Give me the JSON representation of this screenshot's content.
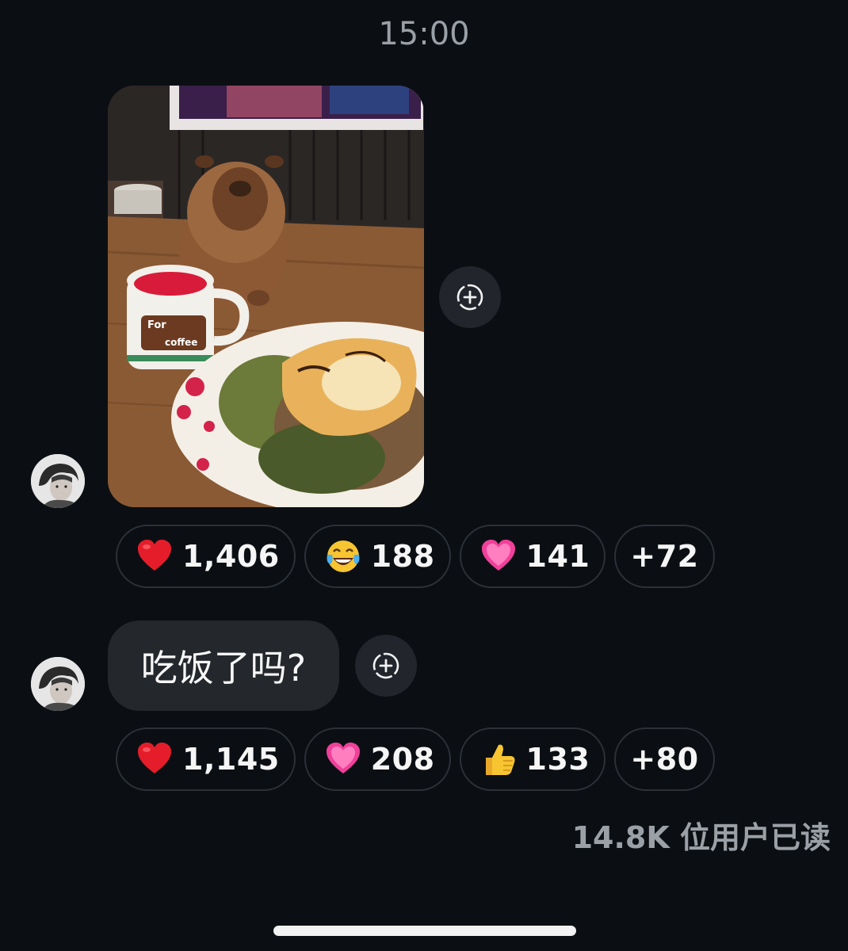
{
  "time": "15:00",
  "message_1": {
    "type": "image",
    "image_alt": "capybara plush with coffee mug and plate of food",
    "mug_text_1": "For",
    "mug_text_2": "coffee",
    "reactions": [
      {
        "emoji": "❤️",
        "icon": "red-heart-icon",
        "count": "1,406"
      },
      {
        "emoji": "😂",
        "icon": "tears-of-joy-icon",
        "count": "188"
      },
      {
        "emoji": "💗",
        "icon": "pink-heart-icon",
        "count": "141"
      }
    ],
    "more_reactions": "+72"
  },
  "message_2": {
    "type": "text",
    "text": "吃饭了吗?",
    "reactions": [
      {
        "emoji": "❤️",
        "icon": "red-heart-icon",
        "count": "1,145"
      },
      {
        "emoji": "💗",
        "icon": "pink-heart-icon",
        "count": "208"
      },
      {
        "emoji": "👍",
        "icon": "thumbs-up-icon",
        "count": "133"
      }
    ],
    "more_reactions": "+80"
  },
  "read_status": "14.8K 位用户已读",
  "colors": {
    "background": "#0b0f14",
    "bubble": "#24272c",
    "pill_border": "#2c3138",
    "muted_text": "#9aa0a6"
  }
}
